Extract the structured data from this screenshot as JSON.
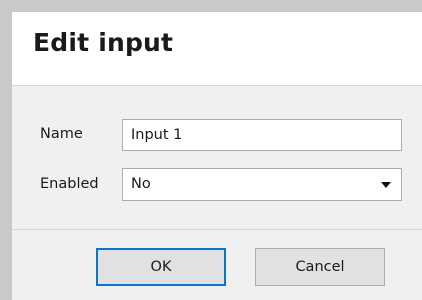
{
  "dialog": {
    "title": "Edit input"
  },
  "form": {
    "name_label": "Name",
    "name_value": "Input 1",
    "enabled_label": "Enabled",
    "enabled_value": "No"
  },
  "buttons": {
    "ok_label": "OK",
    "cancel_label": "Cancel"
  },
  "colors": {
    "accent": "#0078d7",
    "panel": "#f0f0f0",
    "button_face": "#e1e1e1",
    "border": "#adadad"
  },
  "icons": {
    "dropdown": "chevron-down-icon"
  }
}
